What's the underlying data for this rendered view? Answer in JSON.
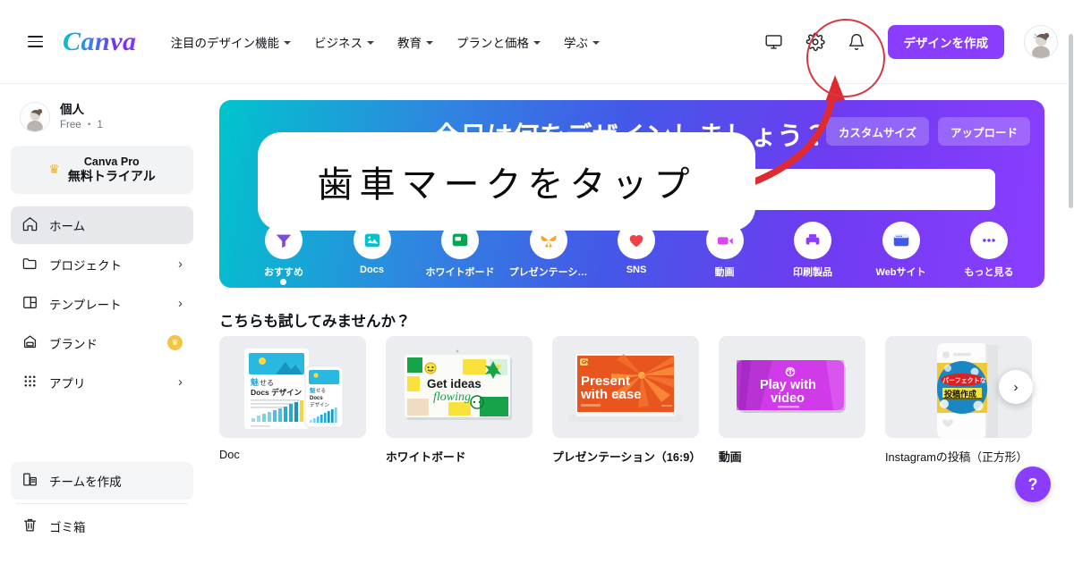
{
  "topnav": {
    "menu_icon": "hamburger-icon",
    "brand": "Canva",
    "links": [
      {
        "label": "注目のデザイン機能",
        "icon": "chevron-down-icon"
      },
      {
        "label": "ビジネス",
        "icon": "chevron-down-icon"
      },
      {
        "label": "教育",
        "icon": "chevron-down-icon"
      },
      {
        "label": "プランと価格",
        "icon": "chevron-down-icon"
      },
      {
        "label": "学ぶ",
        "icon": "chevron-down-icon"
      }
    ],
    "icons": [
      {
        "name": "monitor-icon"
      },
      {
        "name": "gear-icon"
      },
      {
        "name": "bell-icon"
      }
    ],
    "cta_label": "デザインを作成",
    "avatar": "user-avatar"
  },
  "sidebar": {
    "profile": {
      "name": "個人",
      "sub": "Free ・ 1",
      "members": "1",
      "avatar": "account-avatar"
    },
    "pro": {
      "line1": "Canva Pro",
      "line2": "無料トライアル",
      "icon": "crown-icon"
    },
    "items": [
      {
        "label": "ホーム",
        "icon": "home-icon",
        "active": true,
        "trailing": ""
      },
      {
        "label": "プロジェクト",
        "icon": "folder-icon",
        "active": false,
        "trailing": "chevron"
      },
      {
        "label": "テンプレート",
        "icon": "template-icon",
        "active": false,
        "trailing": "chevron"
      },
      {
        "label": "ブランド",
        "icon": "brand-icon",
        "active": false,
        "trailing": "crown"
      },
      {
        "label": "アプリ",
        "icon": "apps-grid-icon",
        "active": false,
        "trailing": "chevron"
      }
    ],
    "bottom": [
      {
        "label": "チームを作成",
        "icon": "team-icon",
        "highlight": true
      },
      {
        "label": "ゴミ箱",
        "icon": "trash-icon",
        "highlight": false
      }
    ]
  },
  "hero": {
    "title": "今日は何をデザインしましょう？",
    "buttons": [
      "カスタムサイズ",
      "アップロード"
    ],
    "search_placeholder": "",
    "search_icon": "search-icon",
    "categories": [
      {
        "label": "おすすめ",
        "icon": "sparkle-icon",
        "active": true
      },
      {
        "label": "Docs",
        "icon": "docs-icon",
        "active": false
      },
      {
        "label": "ホワイトボード",
        "icon": "whiteboard-icon",
        "active": false
      },
      {
        "label": "プレゼンテーシ…",
        "icon": "presentation-icon",
        "active": false
      },
      {
        "label": "SNS",
        "icon": "heart-icon",
        "active": false
      },
      {
        "label": "動画",
        "icon": "video-icon",
        "active": false
      },
      {
        "label": "印刷製品",
        "icon": "print-icon",
        "active": false
      },
      {
        "label": "Webサイト",
        "icon": "website-icon",
        "active": false
      },
      {
        "label": "もっと見る",
        "icon": "more-dots-icon",
        "active": false
      }
    ]
  },
  "section": {
    "title": "こちらも試してみませんか？",
    "cards": [
      {
        "label": "Doc",
        "bold": false,
        "thumb": "doc-thumbnail",
        "thumb_text_main": "魅せる",
        "thumb_text_sub": "Docs デザイン"
      },
      {
        "label": "ホワイトボード",
        "bold": true,
        "thumb": "whiteboard-thumbnail",
        "thumb_text_main": "Get ideas",
        "thumb_text_sub": "flowing"
      },
      {
        "label": "プレゼンテーション（16:9）",
        "bold": true,
        "thumb": "presentation-thumbnail",
        "thumb_text_main": "Present",
        "thumb_text_sub": "with ease"
      },
      {
        "label": "動画",
        "bold": true,
        "thumb": "video-thumbnail",
        "thumb_text_main": "Play with",
        "thumb_text_sub": "video"
      },
      {
        "label": "Instagramの投稿（正方形）",
        "bold": false,
        "thumb": "instagram-thumbnail",
        "thumb_text_main": "パーフェクトな",
        "thumb_text_sub": "投稿作成"
      }
    ],
    "next_icon": "chevron-right-icon"
  },
  "help": {
    "label": "?",
    "icon": "help-icon"
  },
  "annotation": {
    "text": "歯車マークをタップ",
    "circle_target": "gear-icon",
    "color": "#d33a40"
  },
  "colors": {
    "brand_purple": "#8b3dff",
    "hero_gradient_start": "#00c4cc",
    "hero_gradient_end": "#8b3dff",
    "annotation_red": "#d33a40",
    "sidebar_active": "#e6e8ec"
  }
}
